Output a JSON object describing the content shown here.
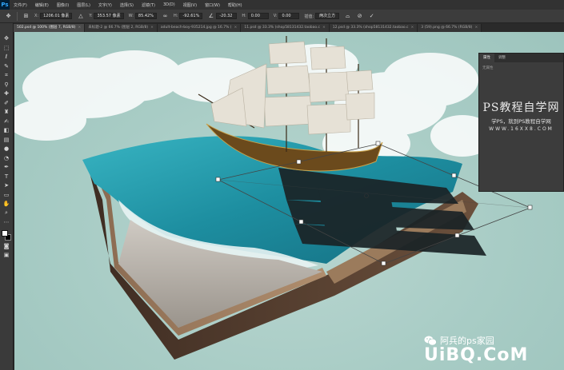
{
  "app": {
    "logo": "Ps",
    "menu": [
      "文件(F)",
      "编辑(E)",
      "图像(I)",
      "图层(L)",
      "文字(Y)",
      "选择(S)",
      "滤镜(T)",
      "3D(D)",
      "视图(V)",
      "窗口(W)",
      "帮助(H)"
    ]
  },
  "options": {
    "x_label": "X:",
    "x_value": "1206.01 像素",
    "y_label": "Y:",
    "y_value": "353.57 像素",
    "w_label": "W:",
    "w_value": "85.42%",
    "h_label": "H:",
    "h_value": "-92.61%",
    "angle_value": "-20.32",
    "h_skew_label": "H:",
    "h_skew_value": "0.00",
    "v_skew_label": "V:",
    "v_skew_value": "0.00",
    "interp_label": "插值:",
    "interp_value": "两次立方"
  },
  "tabs": [
    {
      "label": "502.psd @ 100% (图层 7, RGB/8)",
      "active": true
    },
    {
      "label": "未标题-2 @ 66.7% (图层 2, RGB/8)",
      "active": false
    },
    {
      "label": "adult-beach-boy-935214.jpg @ 16.7% (",
      "active": false
    },
    {
      "label": "11.psd @ 33.3% (shop58131432.taobao.c",
      "active": false
    },
    {
      "label": "12.psd @ 33.3% (shop58131432.taobao.c",
      "active": false
    },
    {
      "label": "3 (59).png @ 66.7% (RGB/8)",
      "active": false
    }
  ],
  "panel": {
    "tabs": [
      "属性",
      "调整"
    ],
    "body": "无属性"
  },
  "watermark": {
    "title": "PS教程自学网",
    "sub": "学PS，就到PS教程自学网",
    "url": "WWW.16XX8.COM"
  },
  "brand": {
    "account": "阿兵的ps家园",
    "site": "UiBQ.CoM"
  },
  "colors": {
    "canvas_bg": "#a8ccc5",
    "water": "#1d8ea0",
    "book_cover": "#5a4232"
  }
}
